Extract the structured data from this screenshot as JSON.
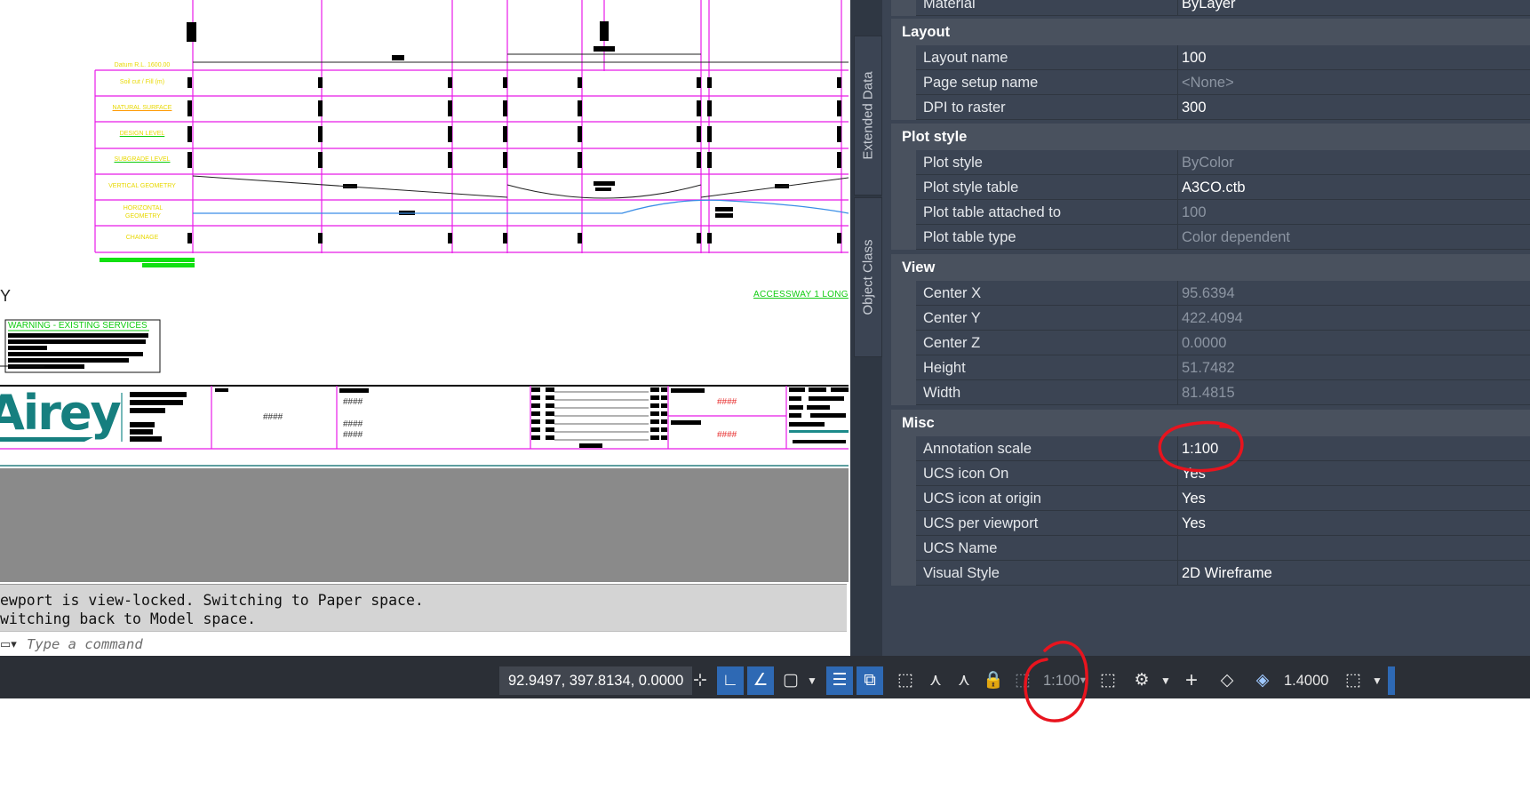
{
  "drawing": {
    "row_labels": [
      "Datum R.L. 1600.00",
      "Soil cut / Fill (m)",
      "NATURAL SURFACE",
      "DESIGN LEVEL",
      "SUBGRADE LEVEL",
      "VERTICAL GEOMETRY",
      "HORIZONTAL GEOMETRY",
      "CHAINAGE"
    ],
    "accessway_label": "ACCESSWAY 1 LONG",
    "warning_title": "WARNING - EXISTING SERVICES",
    "logo_text": "Airey",
    "hash_placeholder": "####",
    "y_axis_letter": "Y"
  },
  "command": {
    "history": [
      "ewport is view-locked. Switching to Paper space.",
      "witching back to Model space."
    ],
    "placeholder": "Type a command"
  },
  "statusbar": {
    "coordinates": "92.9497, 397.8134, 0.0000",
    "annotation_scale": "1:100",
    "lineweight": "1.4000"
  },
  "palette": {
    "side_tabs": [
      "Extended Data",
      "Object Class"
    ],
    "partial_row": {
      "name": "Material",
      "value": "ByLayer"
    },
    "sections": [
      {
        "title": "Layout",
        "rows": [
          {
            "name": "Layout name",
            "value": "100",
            "readonly": false
          },
          {
            "name": "Page setup name",
            "value": "<None>",
            "readonly": true
          },
          {
            "name": "DPI to raster",
            "value": "300",
            "readonly": false
          }
        ]
      },
      {
        "title": "Plot style",
        "rows": [
          {
            "name": "Plot style",
            "value": "ByColor",
            "readonly": true
          },
          {
            "name": "Plot style table",
            "value": "A3CO.ctb",
            "readonly": false
          },
          {
            "name": "Plot table attached to",
            "value": "100",
            "readonly": true
          },
          {
            "name": "Plot table type",
            "value": "Color dependent",
            "readonly": true
          }
        ]
      },
      {
        "title": "View",
        "rows": [
          {
            "name": "Center X",
            "value": "95.6394",
            "readonly": true
          },
          {
            "name": "Center Y",
            "value": "422.4094",
            "readonly": true
          },
          {
            "name": "Center Z",
            "value": "0.0000",
            "readonly": true
          },
          {
            "name": "Height",
            "value": "51.7482",
            "readonly": true
          },
          {
            "name": "Width",
            "value": "81.4815",
            "readonly": true
          }
        ]
      },
      {
        "title": "Misc",
        "rows": [
          {
            "name": "Annotation scale",
            "value": "1:100",
            "readonly": false
          },
          {
            "name": "UCS icon On",
            "value": "Yes",
            "readonly": false
          },
          {
            "name": "UCS icon at origin",
            "value": "Yes",
            "readonly": false
          },
          {
            "name": "UCS per viewport",
            "value": "Yes",
            "readonly": false
          },
          {
            "name": "UCS Name",
            "value": "",
            "readonly": false
          },
          {
            "name": "Visual Style",
            "value": "2D Wireframe",
            "readonly": false
          }
        ]
      }
    ]
  }
}
